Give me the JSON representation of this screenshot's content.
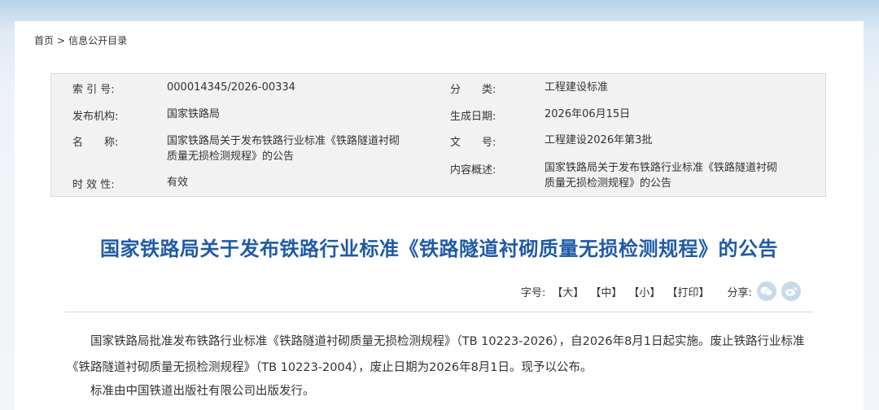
{
  "breadcrumb": {
    "home": "首页",
    "separator": ">",
    "current": "信息公开目录"
  },
  "meta": {
    "index_label": "索 引 号:",
    "index_value": "000014345/2026-00334",
    "category_label": "分　　类:",
    "category_value": "工程建设标准",
    "publisher_label": "发布机构:",
    "publisher_value": "国家铁路局",
    "date_label": "生成日期:",
    "date_value": "2026年06月15日",
    "name_label": "名　　称:",
    "name_value_1": "国家铁路局关于发布铁路行业标准《铁路隧道衬砌",
    "name_value_2": "质量无损检测规程》的公告",
    "docno_label": "文　　号:",
    "docno_value": "工程建设2026年第3批",
    "summary_label": "内容概述:",
    "summary_value_1": "国家铁路局关于发布铁路行业标准《铁路隧道衬砌",
    "summary_value_2": "质量无损检测规程》的公告",
    "validity_label": "时 效 性:",
    "validity_value": "有效"
  },
  "article": {
    "title": "国家铁路局关于发布铁路行业标准《铁路隧道衬砌质量无损检测规程》的公告",
    "paragraphs": [
      "国家铁路局批准发布铁路行业标准《铁路隧道衬砌质量无损检测规程》（TB 10223-2026），自2026年8月1日起实施。废止铁路行业标准《铁路隧道衬砌质量无损检测规程》（TB 10223-2004），废止日期为2026年8月1日。现予以公布。",
      "标准由中国铁道出版社有限公司出版发行。"
    ]
  },
  "tools": {
    "font_label": "字号:",
    "large": "【大】",
    "medium": "【中】",
    "small": "【小】",
    "print": "【打印】",
    "share_label": "分享:",
    "share_icons": [
      "wechat-icon",
      "weibo-icon"
    ]
  },
  "colors": {
    "title": "#1f5aa6",
    "meta_bg": "#f2f2f2",
    "share_icon_bg": "#c9d9ea"
  }
}
